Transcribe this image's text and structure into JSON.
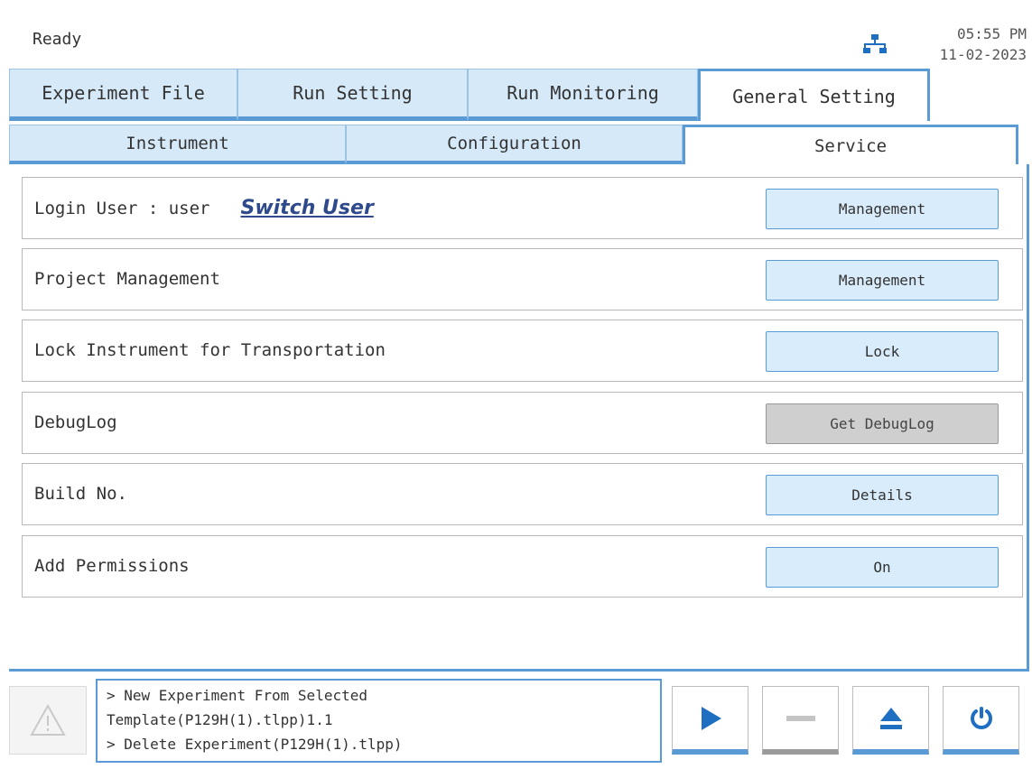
{
  "status": {
    "text": "Ready",
    "time": "05:55 PM",
    "date": "11-02-2023"
  },
  "main_tabs": [
    {
      "label": "Experiment File",
      "active": false
    },
    {
      "label": "Run Setting",
      "active": false
    },
    {
      "label": "Run Monitoring",
      "active": false
    },
    {
      "label": "General Setting",
      "active": true
    }
  ],
  "sub_tabs": [
    {
      "label": "Instrument",
      "active": false
    },
    {
      "label": "Configuration",
      "active": false
    },
    {
      "label": "Service",
      "active": true
    }
  ],
  "rows": [
    {
      "label": "Login User : user",
      "link": "Switch User",
      "button": "Management",
      "button_enabled": true
    },
    {
      "label": "Project Management",
      "button": "Management",
      "button_enabled": true
    },
    {
      "label": "Lock Instrument for Transportation",
      "button": "Lock",
      "button_enabled": true
    },
    {
      "label": "DebugLog",
      "button": "Get DebugLog",
      "button_enabled": false
    },
    {
      "label": "Build No.",
      "button": "Details",
      "button_enabled": true
    },
    {
      "label": "Add Permissions",
      "button": "On",
      "button_enabled": true
    }
  ],
  "log": {
    "lines": [
      "> New Experiment From Selected",
      "Template(P129H(1).tlpp)1.1",
      "> Delete Experiment(P129H(1).tlpp)"
    ]
  },
  "controls": {
    "warning_icon": "warning-triangle-icon",
    "play_icon": "play-icon",
    "stop_icon": "stop-icon",
    "eject_icon": "eject-icon",
    "power_icon": "power-icon",
    "stop_enabled": false
  },
  "colors": {
    "accent": "#5b9bd5",
    "tab_bg": "#d5e9f8",
    "button_bg": "#d9ecfb",
    "disabled_bg": "#cfcfcf",
    "icon_blue": "#1e6fc2",
    "link": "#2e4a8c"
  }
}
